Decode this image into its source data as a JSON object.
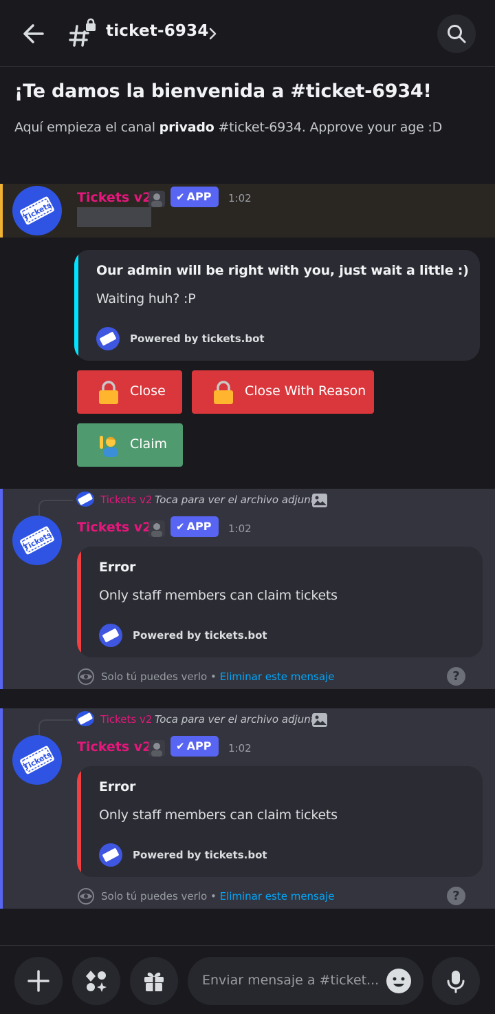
{
  "header": {
    "channel_name": "ticket-6934"
  },
  "welcome": {
    "title": "¡Te damos la bienvenida a #ticket-6934!",
    "sub_prefix": "Aquí empieza el canal ",
    "sub_bold": "privado",
    "sub_suffix": " #ticket-6934. Approve your age :D"
  },
  "messages": [
    {
      "author": "Tickets v2",
      "badge": "APP",
      "time": "1:02",
      "embed": {
        "title": "Our admin will be right with you, just wait a little :)",
        "description": "Waiting huh? :P",
        "footer": "Powered by tickets.bot",
        "color": "#00e5ff"
      },
      "buttons": [
        {
          "label": "Close",
          "icon": "lock-icon"
        },
        {
          "label": "Close With Reason",
          "icon": "lock-icon"
        },
        {
          "label": "Claim",
          "icon": "person-raising-hand-icon"
        }
      ]
    },
    {
      "reply_author": "Tickets v2",
      "reply_text": "Toca para ver el archivo adjunto",
      "author": "Tickets v2",
      "badge": "APP",
      "time": "1:02",
      "embed": {
        "title": "Error",
        "description": "Only staff members can claim tickets",
        "footer": "Powered by tickets.bot",
        "color": "#f23f42"
      },
      "ephemeral_note": "Solo tú puedes verlo • ",
      "ephemeral_link": "Eliminar este mensaje",
      "help": "?"
    },
    {
      "reply_author": "Tickets v2",
      "reply_text": "Toca para ver el archivo adjunto",
      "author": "Tickets v2",
      "badge": "APP",
      "time": "1:02",
      "embed": {
        "title": "Error",
        "description": "Only staff members can claim tickets",
        "footer": "Powered by tickets.bot",
        "color": "#f23f42"
      },
      "ephemeral_note": "Solo tú puedes verlo • ",
      "ephemeral_link": "Eliminar este mensaje",
      "help": "?"
    }
  ],
  "composer": {
    "placeholder": "Enviar mensaje a #ticket..."
  },
  "colors": {
    "background": "#1a1a1e",
    "author": "#e6177c",
    "app_badge": "#5865f2",
    "button_red": "#da373c",
    "button_green": "#4f9a6e",
    "link": "#00a8fc"
  }
}
